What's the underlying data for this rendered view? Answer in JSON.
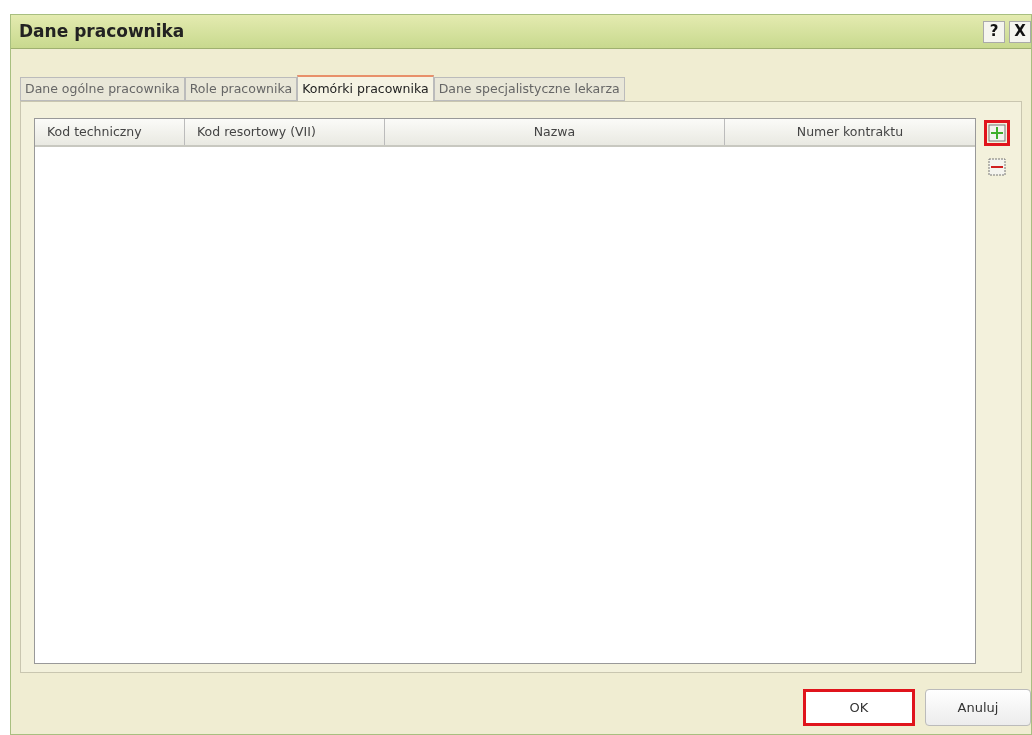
{
  "window": {
    "title": "Dane pracownika",
    "title_buttons": [
      "?",
      "X"
    ]
  },
  "tabs": [
    {
      "label": "Dane ogólne pracownika",
      "selected": false
    },
    {
      "label": "Role pracownika",
      "selected": false
    },
    {
      "label": "Komórki pracownika",
      "selected": true
    },
    {
      "label": "Dane specjalistyczne lekarza",
      "selected": false
    }
  ],
  "table": {
    "columns": [
      "Kod techniczny",
      "Kod resortowy (VII)",
      "Nazwa",
      "Numer kontraktu"
    ]
  },
  "side_buttons": [
    {
      "kind": "add",
      "highlighted": true
    },
    {
      "kind": "remove",
      "highlighted": false
    }
  ],
  "buttons": [
    {
      "label": "OK",
      "highlighted": true
    },
    {
      "label": "Anuluj",
      "highlighted": false
    }
  ]
}
